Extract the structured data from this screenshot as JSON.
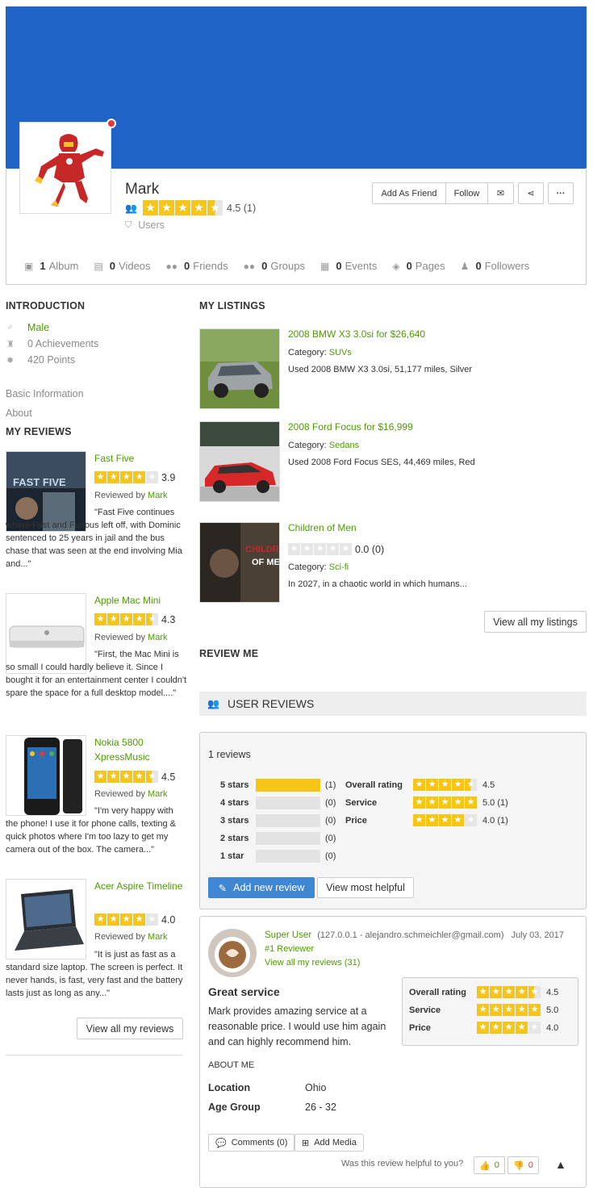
{
  "profile": {
    "name": "Mark",
    "rating": "4.5 (1)",
    "group": "Users",
    "buttons": {
      "add_friend": "Add As Friend",
      "follow": "Follow"
    }
  },
  "stats": [
    {
      "count": "1",
      "label": "Album",
      "icon": "album-icon"
    },
    {
      "count": "0",
      "label": "Videos",
      "icon": "video-icon"
    },
    {
      "count": "0",
      "label": "Friends",
      "icon": "friends-icon"
    },
    {
      "count": "0",
      "label": "Groups",
      "icon": "groups-icon"
    },
    {
      "count": "0",
      "label": "Events",
      "icon": "calendar-icon"
    },
    {
      "count": "0",
      "label": "Pages",
      "icon": "cube-icon"
    },
    {
      "count": "0",
      "label": "Followers",
      "icon": "followers-icon"
    }
  ],
  "intro": {
    "title": "INTRODUCTION",
    "gender": "Male",
    "achievements": "0 Achievements",
    "points": "420 Points",
    "basic_info": "Basic Information",
    "about": "About"
  },
  "my_reviews": {
    "title": "MY REVIEWS",
    "reviewed_by_label": "Reviewed by",
    "reviewer": "Mark",
    "items": [
      {
        "title": "Fast Five",
        "rating": "3.9",
        "text": "\"Fast Five continues where Fast and Furious left off, with Dominic sentenced to 25 years in jail and the bus chase that was seen at the end involving Mia and...\""
      },
      {
        "title": "Apple Mac Mini",
        "rating": "4.3",
        "text": "\"First, the Mac Mini is so small I could hardly believe it. Since I bought it for an entertainment center I couldn't spare the space for a full desktop model....\""
      },
      {
        "title": "Nokia 5800 XpressMusic",
        "rating": "4.5",
        "text": "\"I'm very happy with the phone! I use it for phone calls, texting & quick photos where I'm too lazy to get my camera out of the box. The camera...\""
      },
      {
        "title": "Acer Aspire Timeline",
        "rating": "4.0",
        "text": "\"It is just as fast as a standard size laptop. The screen is perfect. It never hands, is fast, very fast and the battery lasts just as long as any...\""
      }
    ],
    "view_all": "View all my reviews"
  },
  "listings": {
    "title": "MY LISTINGS",
    "category_label": "Category:",
    "items": [
      {
        "title": "2008 BMW X3 3.0si for $26,640",
        "category": "SUVs",
        "desc": "Used 2008 BMW X3 3.0si, 51,177 miles, Silver"
      },
      {
        "title": "2008 Ford Focus for $16,999",
        "category": "Sedans",
        "desc": "Used 2008 Ford Focus SES, 44,469 miles, Red"
      },
      {
        "title": "Children of Men",
        "rating": "0.0 (0)",
        "category": "Sci-fi",
        "desc": "In 2027, in a chaotic world in which humans..."
      }
    ],
    "view_all": "View all my listings"
  },
  "review_me": {
    "title": "REVIEW ME"
  },
  "user_reviews": {
    "title": "USER REVIEWS",
    "count": "1 reviews",
    "bars": [
      {
        "label": "5 stars",
        "count": "(1)",
        "fraction": 1
      },
      {
        "label": "4 stars",
        "count": "(0)",
        "fraction": 0
      },
      {
        "label": "3 stars",
        "count": "(0)",
        "fraction": 0
      },
      {
        "label": "2 stars",
        "count": "(0)",
        "fraction": 0
      },
      {
        "label": "1 star",
        "count": "(0)",
        "fraction": 0
      }
    ],
    "summary": [
      {
        "label": "Overall rating",
        "value": "4.5",
        "stars": 4.5
      },
      {
        "label": "Service",
        "value": "5.0  (1)",
        "stars": 5
      },
      {
        "label": "Price",
        "value": "4.0  (1)",
        "stars": 4
      }
    ],
    "add_review": "Add new review",
    "most_helpful": "View most helpful"
  },
  "review": {
    "author": "Super User",
    "meta": "(127.0.0.1 -  alejandro.schmeichler@gmail.com)",
    "date": "July 03, 2017",
    "rank": "#1 Reviewer",
    "view_all": "View all my reviews (31)",
    "title": "Great service",
    "body": "Mark provides amazing service at a reasonable price. I would use him again and can highly recommend him.",
    "ratings": [
      {
        "label": "Overall rating",
        "value": "4.5"
      },
      {
        "label": "Service",
        "value": "5.0"
      },
      {
        "label": "Price",
        "value": "4.0"
      }
    ],
    "about_title": "ABOUT ME",
    "location_label": "Location",
    "location": "Ohio",
    "age_label": "Age Group",
    "age": "26 - 32",
    "comments_btn": "Comments (0)",
    "media_btn": "Add Media",
    "helpful_q": "Was this review helpful to you?",
    "yes": "0",
    "no": "0"
  }
}
